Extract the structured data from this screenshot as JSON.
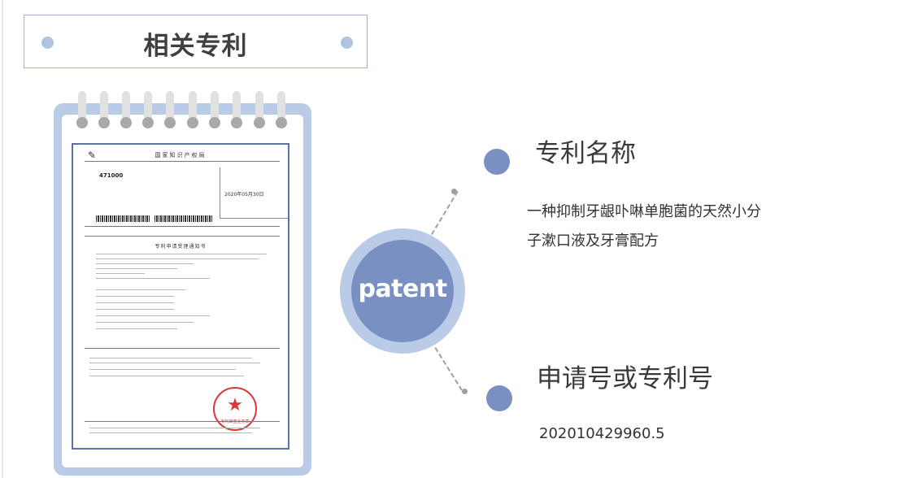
{
  "header": {
    "title": "相关专利"
  },
  "center": {
    "label": "patent"
  },
  "patent_name": {
    "label": "专利名称",
    "value_line1": "一种抑制牙龈卟啉单胞菌的天然小分",
    "value_line2": "子漱口液及牙膏配方"
  },
  "patent_number": {
    "label": "申请号或专利号",
    "value": "202010429960.5"
  },
  "certificate": {
    "issuer": "国家知识产权局",
    "postal_code": "471000",
    "date": "2020年05月30日",
    "title": "专利申请受理通知书",
    "stamp_text": "专利审查业务章"
  },
  "colors": {
    "accent": "#7b90c2",
    "light": "#b9cbe6"
  }
}
